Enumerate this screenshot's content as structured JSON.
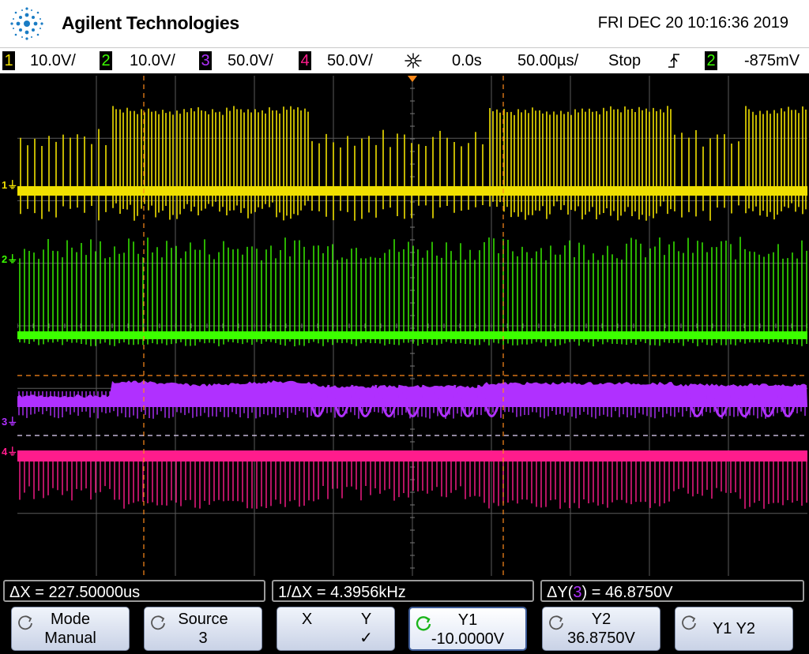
{
  "header": {
    "brand": "Agilent Technologies",
    "datetime": "FRI DEC 20 10:16:36 2019"
  },
  "status_bar": {
    "channels": [
      {
        "num": "1",
        "scale": "10.0V/",
        "color": "#f0e000"
      },
      {
        "num": "2",
        "scale": "10.0V/",
        "color": "#3cff00"
      },
      {
        "num": "3",
        "scale": "50.0V/",
        "color": "#b030ff"
      },
      {
        "num": "4",
        "scale": "50.0V/",
        "color": "#ff1c8c"
      }
    ],
    "delay": "0.0s",
    "timebase": "50.00µs/",
    "run_state": "Stop",
    "trigger_slope": "↑",
    "trigger_channel": "2",
    "trigger_level": "-875mV"
  },
  "grid": {
    "channel_markers": [
      {
        "label": "1",
        "color": "#f0e000"
      },
      {
        "label": "2",
        "color": "#3cff00"
      },
      {
        "label": "3",
        "color": "#b030ff"
      },
      {
        "label": "4",
        "color": "#ff1c8c"
      }
    ],
    "colors": {
      "grid": "#5a5a5a",
      "cursor": "#ff8a1a",
      "trigger_marker": "#ff8a1a"
    }
  },
  "measurements": {
    "delta_x": "ΔX = 227.50000us",
    "inv_delta_x": "1/ΔX = 4.3956kHz",
    "delta_y_prefix": "ΔY(",
    "delta_y_source": "3",
    "delta_y_suffix": ") = 46.8750V"
  },
  "softkeys": [
    {
      "title": "Mode",
      "value": "Manual",
      "icon": "rotate-knob-icon"
    },
    {
      "title": "Source",
      "value": "3",
      "icon": "rotate-knob-icon"
    },
    {
      "title_left": "X",
      "title_right": "Y",
      "value": "✓"
    },
    {
      "title": "Y1",
      "value": "-10.0000V",
      "icon": "rotate-knob-active-icon"
    },
    {
      "title": "Y2",
      "value": "36.8750V",
      "icon": "rotate-knob-icon"
    },
    {
      "title": "Y1 Y2",
      "value": "",
      "icon": "rotate-knob-icon"
    }
  ]
}
